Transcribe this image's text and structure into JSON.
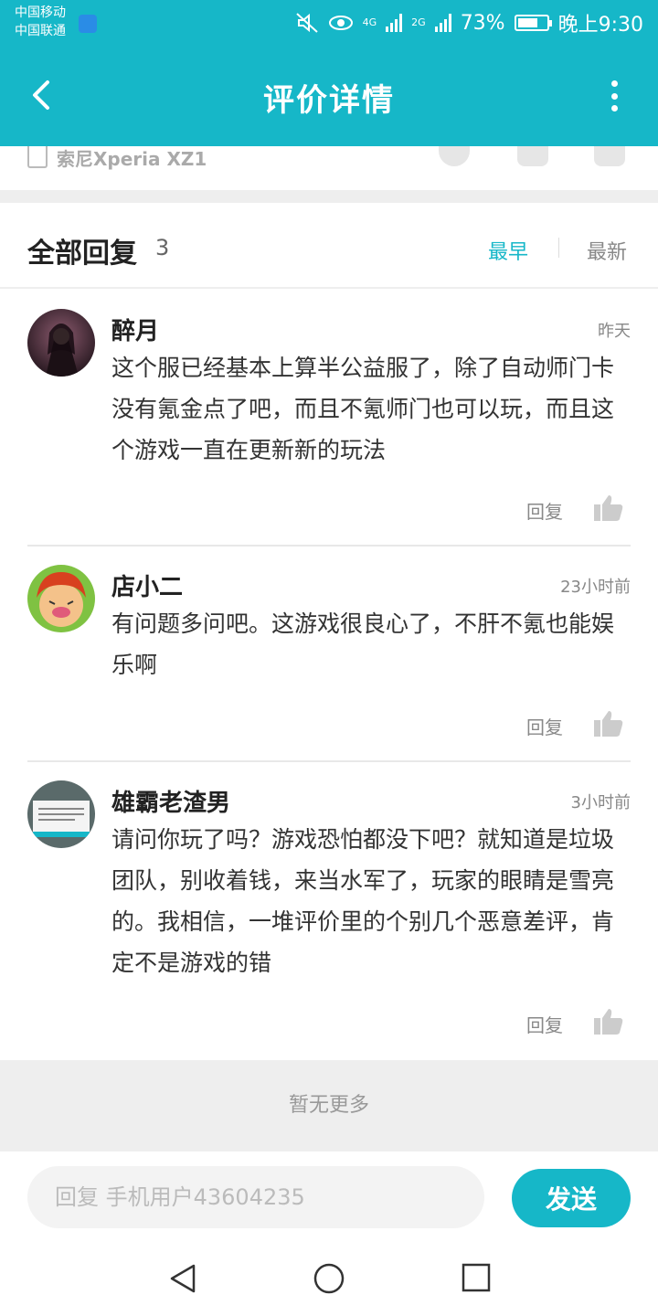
{
  "status_bar": {
    "carrier1": "中国移动",
    "carrier2": "中国联通",
    "net1": "4G",
    "net2": "2G",
    "battery": "73%",
    "battery_level": 0.73,
    "time": "晚上9:30"
  },
  "header": {
    "title": "评价详情"
  },
  "device": {
    "name": "索尼Xperia XZ1"
  },
  "replies_section": {
    "title": "全部回复",
    "count": "3",
    "sort_earliest": "最早",
    "sort_latest": "最新"
  },
  "comments": [
    {
      "name": "醉月",
      "time": "昨天",
      "text": "这个服已经基本上算半公益服了，除了自动师门卡没有氪金点了吧，而且不氪师门也可以玩，而且这个游戏一直在更新新的玩法",
      "reply_label": "回复"
    },
    {
      "name": "店小二",
      "time": "23小时前",
      "text": "有问题多问吧。这游戏很良心了，不肝不氪也能娱乐啊",
      "reply_label": "回复"
    },
    {
      "name": "雄霸老渣男",
      "time": "3小时前",
      "text": "请问你玩了吗？游戏恐怕都没下吧？就知道是垃圾团队，别收着钱，来当水军了，玩家的眼睛是雪亮的。我相信，一堆评价里的个别几个恶意差评，肯定不是游戏的错",
      "reply_label": "回复"
    }
  ],
  "footer": {
    "no_more": "暂无更多"
  },
  "composer": {
    "placeholder": "回复 手机用户43604235",
    "send_label": "发送"
  },
  "colors": {
    "accent": "#16b7c8"
  }
}
